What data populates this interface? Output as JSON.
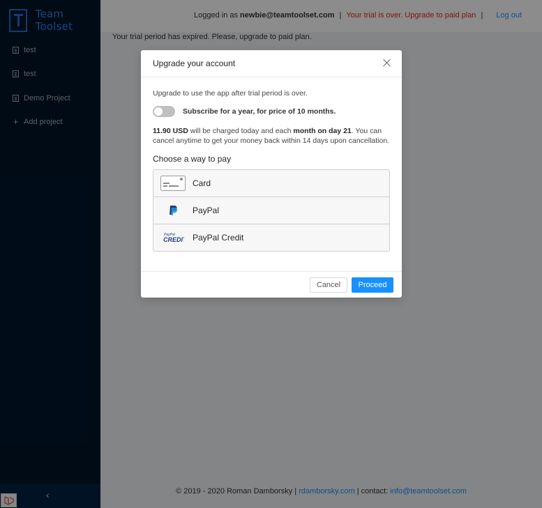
{
  "app": {
    "name": "Team Toolset"
  },
  "sidebar": {
    "items": [
      {
        "label": "test",
        "icon": "project-icon"
      },
      {
        "label": "test",
        "icon": "project-icon"
      },
      {
        "label": "Demo Project",
        "icon": "project-icon"
      },
      {
        "label": "Add project",
        "icon": "plus-icon"
      }
    ],
    "collapse_glyph": "‹"
  },
  "header": {
    "logged_prefix": "Logged in as",
    "user_email": "newbie@teamtoolset.com",
    "separator": "|",
    "trial_link": "Your trial is over. Upgrade to paid plan",
    "logout": "Log out"
  },
  "main": {
    "notice": "Your trial period has expired. Please, upgrade to paid plan."
  },
  "modal": {
    "title": "Upgrade your account",
    "intro": "Upgrade to use the app after trial period is over.",
    "toggle_label": "Subscribe for a year, for price of 10 months.",
    "toggle_on": false,
    "price_amount": "11.90 USD",
    "price_mid": "will be charged today and each",
    "price_period": "month on day 21",
    "price_rest": ". You can cancel anytime to get your money back within 14 days upon cancellation.",
    "choose_label": "Choose a way to pay",
    "payment_methods": [
      {
        "label": "Card",
        "icon": "credit-card-icon"
      },
      {
        "label": "PayPal",
        "icon": "paypal-icon"
      },
      {
        "label": "PayPal Credit",
        "icon": "paypal-credit-icon"
      }
    ],
    "paypal_credit_logo_small": "PayPal",
    "paypal_credit_logo_big": "CREDIT",
    "cancel": "Cancel",
    "proceed": "Proceed"
  },
  "footer": {
    "copyright": "© 2019 - 2020 Roman Damborsky |",
    "site": "rdamborsky.com",
    "contact_prefix": "| contact:",
    "email": "info@teamtoolset.com"
  },
  "colors": {
    "sidebar": "#001529",
    "accent": "#1890ff",
    "warning": "#e8231e"
  }
}
